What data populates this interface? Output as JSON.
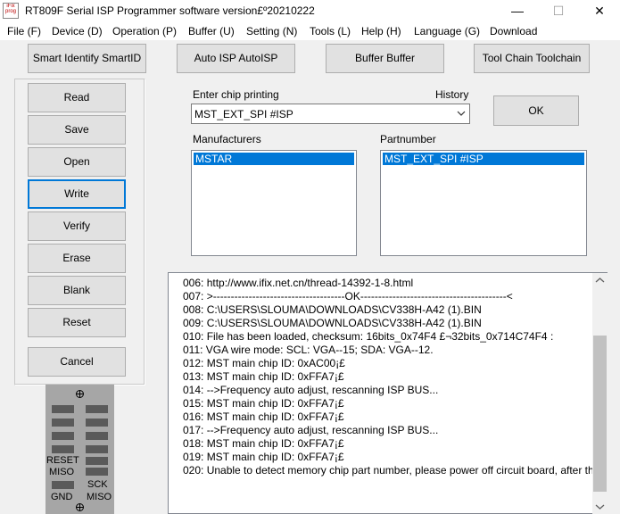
{
  "window": {
    "title": "RT809F Serial ISP Programmer software version£º20210222",
    "icon_text": "iFix prog"
  },
  "menu": [
    "File (F)",
    "Device (D)",
    "Operation (P)",
    "Buffer (U)",
    "Setting (N)",
    "Tools (L)",
    "Help (H)",
    "Language (G)",
    "Download"
  ],
  "toolbar": {
    "smart_identify": "Smart Identify SmartID",
    "auto_isp": "Auto ISP AutoISP",
    "buffer": "Buffer Buffer",
    "tool_chain": "Tool Chain Toolchain"
  },
  "side_buttons": [
    "Read",
    "Save",
    "Open",
    "Write",
    "Verify",
    "Erase",
    "Blank",
    "Reset"
  ],
  "cancel_label": "Cancel",
  "chip_search": {
    "label": "Enter chip printing",
    "value": "MST_EXT_SPI #ISP",
    "history_label": "History",
    "ok_label": "OK"
  },
  "manufacturers": {
    "label": "Manufacturers",
    "selected": "MSTAR"
  },
  "partnumber": {
    "label": "Partnumber",
    "selected": "MST_EXT_SPI #ISP"
  },
  "log": [
    "006:  http://www.ifix.net.cn/thread-14392-1-8.html",
    "007:  >-------------------------------------OK-----------------------------------------<",
    "008:  C:\\USERS\\SLOUMA\\DOWNLOADS\\CV338H-A42 (1).BIN",
    "009:  C:\\USERS\\SLOUMA\\DOWNLOADS\\CV338H-A42 (1).BIN",
    "010:  File has been loaded, checksum: 16bits_0x74F4 £¬32bits_0x714C74F4 :",
    "011:  VGA wire mode: SCL: VGA--15; SDA: VGA--12.",
    "012:  MST main chip ID: 0xAC00¡£",
    "013:  MST main chip ID: 0xFFA7¡£",
    "014:  -->Frequency auto adjust, rescanning ISP BUS...",
    "015:  MST main chip ID: 0xFFA7¡£",
    "016:  MST main chip ID: 0xFFA7¡£",
    "017:  -->Frequency auto adjust, rescanning ISP BUS...",
    "018:  MST main chip ID: 0xFFA7¡£",
    "019:  MST main chip ID: 0xFFA7¡£",
    "020:  Unable to detect memory chip part number, please power off circuit board, after th"
  ],
  "connector": {
    "reset": "RESET",
    "miso_left": "MISO",
    "gnd": "GND",
    "sck": "SCK",
    "miso_right": "MISO"
  },
  "colors": {
    "selection": "#0078d7",
    "focus_border": "#0078d7",
    "chip_body": "#a6a6a6"
  }
}
